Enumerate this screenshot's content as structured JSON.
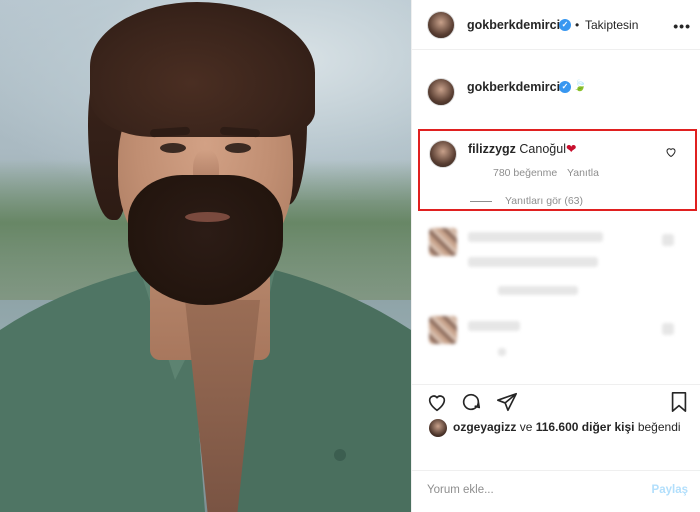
{
  "header": {
    "username": "gokberkdemirci",
    "separator": "•",
    "follow_status": "Takiptesin",
    "more_icon": "more-horizontal-icon"
  },
  "caption": {
    "username": "gokberkdemirci",
    "emoji_icon": "leaf-emoji-icon"
  },
  "highlighted_comment": {
    "username": "filizzygz",
    "text": "Canoğul",
    "emoji": "❤",
    "likes": "780 beğenme",
    "reply_label": "Yanıtla",
    "view_replies": "Yanıtları gör (63)",
    "highlight_color": "#e02020"
  },
  "actions": {
    "like_icon": "heart-icon",
    "comment_icon": "comment-icon",
    "share_icon": "share-icon",
    "save_icon": "bookmark-icon"
  },
  "likes_line": {
    "username": "ozgeyagizz",
    "connector": "ve",
    "count": "116.600 diğer kişi",
    "suffix": "beğendi"
  },
  "comment_input": {
    "placeholder": "Yorum ekle...",
    "post_label": "Paylaş"
  },
  "colors": {
    "verified": "#3897f0",
    "text": "#262626",
    "muted": "#8e8e8e"
  }
}
